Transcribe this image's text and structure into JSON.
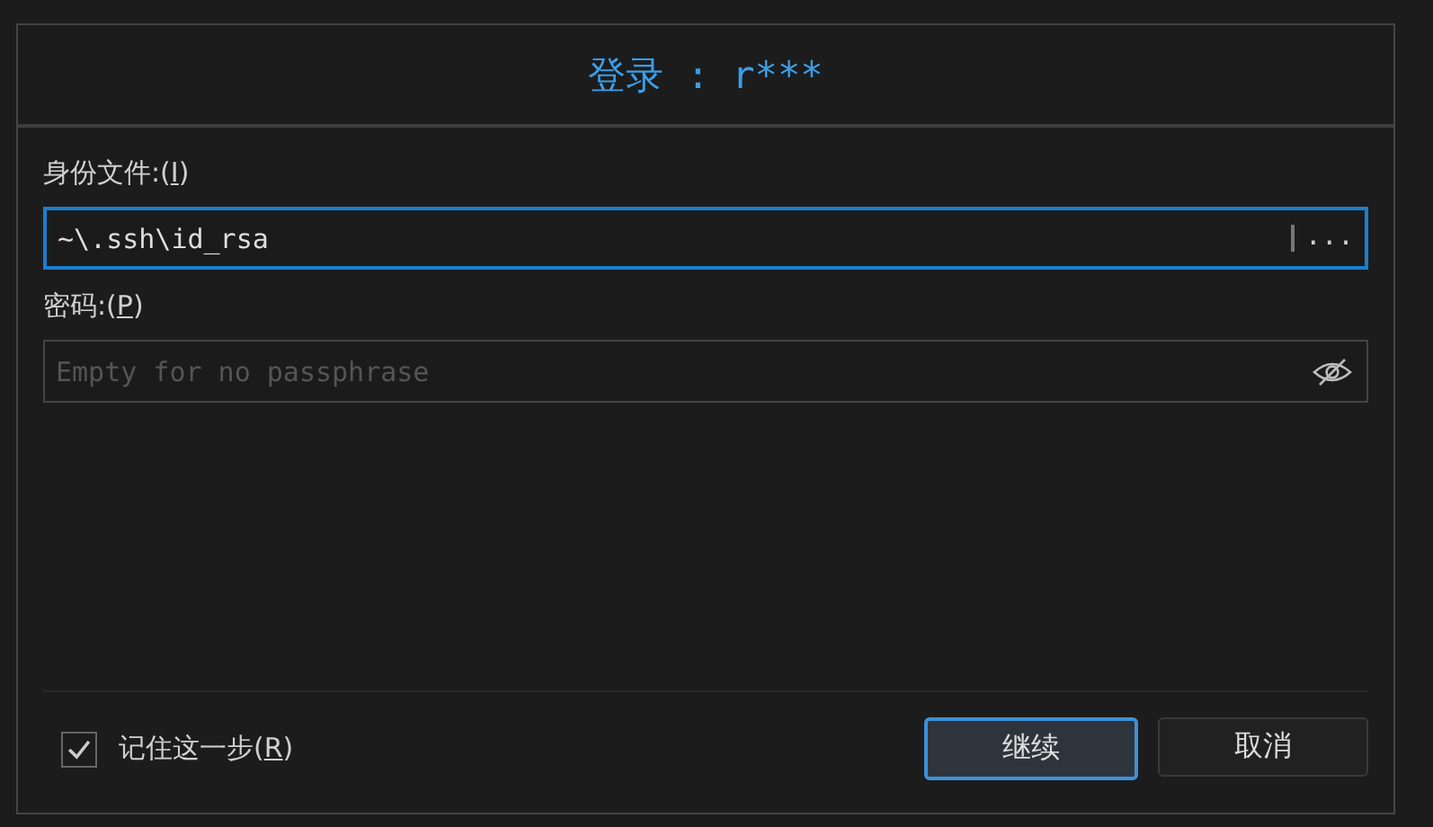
{
  "dialog": {
    "title": "登录 : r***"
  },
  "identity": {
    "label_prefix": "身份文件:(",
    "access_key": "I",
    "label_suffix": ")",
    "value": "~\\.ssh\\id_rsa",
    "focused": true,
    "browse": "..."
  },
  "password": {
    "label_prefix": "密码:(",
    "access_key": "P",
    "label_suffix": ")",
    "placeholder": "Empty for no passphrase"
  },
  "remember": {
    "label_prefix": "记住这一步(",
    "access_key": "R",
    "label_suffix": ")",
    "checked": true
  },
  "buttons": [
    {
      "label": "继续",
      "default": true
    },
    {
      "label": "取消",
      "default": false
    }
  ]
}
